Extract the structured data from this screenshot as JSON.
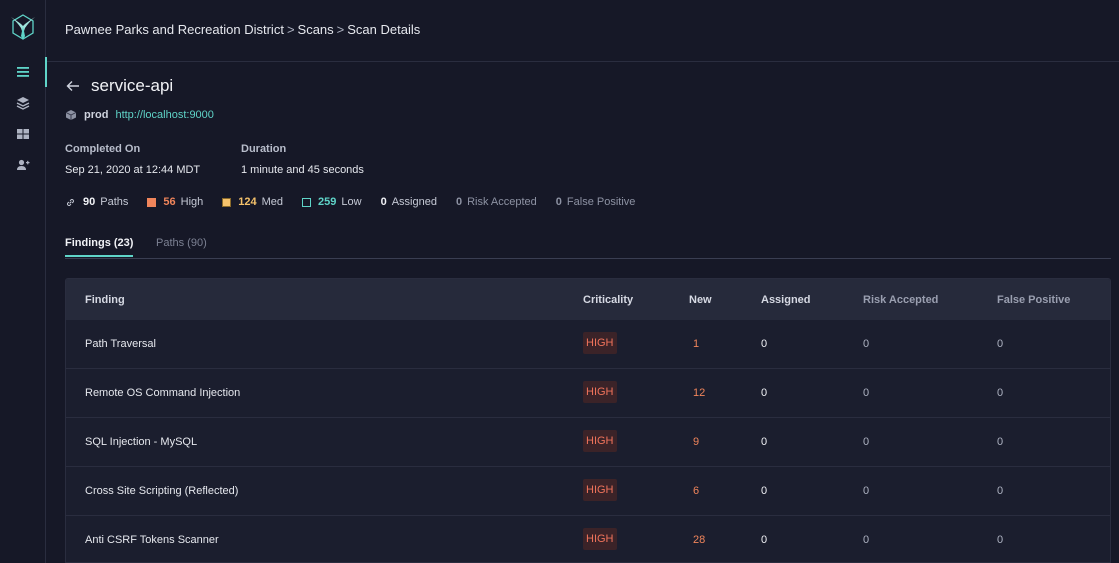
{
  "breadcrumb": [
    "Pawnee Parks and Recreation District",
    "Scans",
    "Scan Details"
  ],
  "scan": {
    "name": "service-api",
    "env": "prod",
    "url": "http://localhost:9000",
    "completed_label": "Completed On",
    "completed_value": "Sep 21, 2020 at 12:44 MDT",
    "duration_label": "Duration",
    "duration_value": "1 minute and 45 seconds"
  },
  "stats": {
    "paths": {
      "count": "90",
      "label": "Paths"
    },
    "high": {
      "count": "56",
      "label": "High"
    },
    "med": {
      "count": "124",
      "label": "Med"
    },
    "low": {
      "count": "259",
      "label": "Low"
    },
    "assigned": {
      "count": "0",
      "label": "Assigned"
    },
    "risk": {
      "count": "0",
      "label": "Risk Accepted"
    },
    "fp": {
      "count": "0",
      "label": "False Positive"
    }
  },
  "tabs": [
    {
      "label": "Findings (23)"
    },
    {
      "label": "Paths (90)"
    }
  ],
  "table": {
    "headers": [
      "Finding",
      "Criticality",
      "New",
      "Assigned",
      "Risk Accepted",
      "False Positive"
    ],
    "rows": [
      {
        "finding": "Path Traversal",
        "criticality": "HIGH",
        "new": "1",
        "assigned": "0",
        "risk": "0",
        "fp": "0"
      },
      {
        "finding": "Remote OS Command Injection",
        "criticality": "HIGH",
        "new": "12",
        "assigned": "0",
        "risk": "0",
        "fp": "0"
      },
      {
        "finding": "SQL Injection - MySQL",
        "criticality": "HIGH",
        "new": "9",
        "assigned": "0",
        "risk": "0",
        "fp": "0"
      },
      {
        "finding": "Cross Site Scripting (Reflected)",
        "criticality": "HIGH",
        "new": "6",
        "assigned": "0",
        "risk": "0",
        "fp": "0"
      },
      {
        "finding": "Anti CSRF Tokens Scanner",
        "criticality": "HIGH",
        "new": "28",
        "assigned": "0",
        "risk": "0",
        "fp": "0"
      }
    ]
  },
  "colors": {
    "accent": "#5fd4c8",
    "high": "#f0735b",
    "med": "#f5c26b",
    "low": "#5fd4c8"
  }
}
